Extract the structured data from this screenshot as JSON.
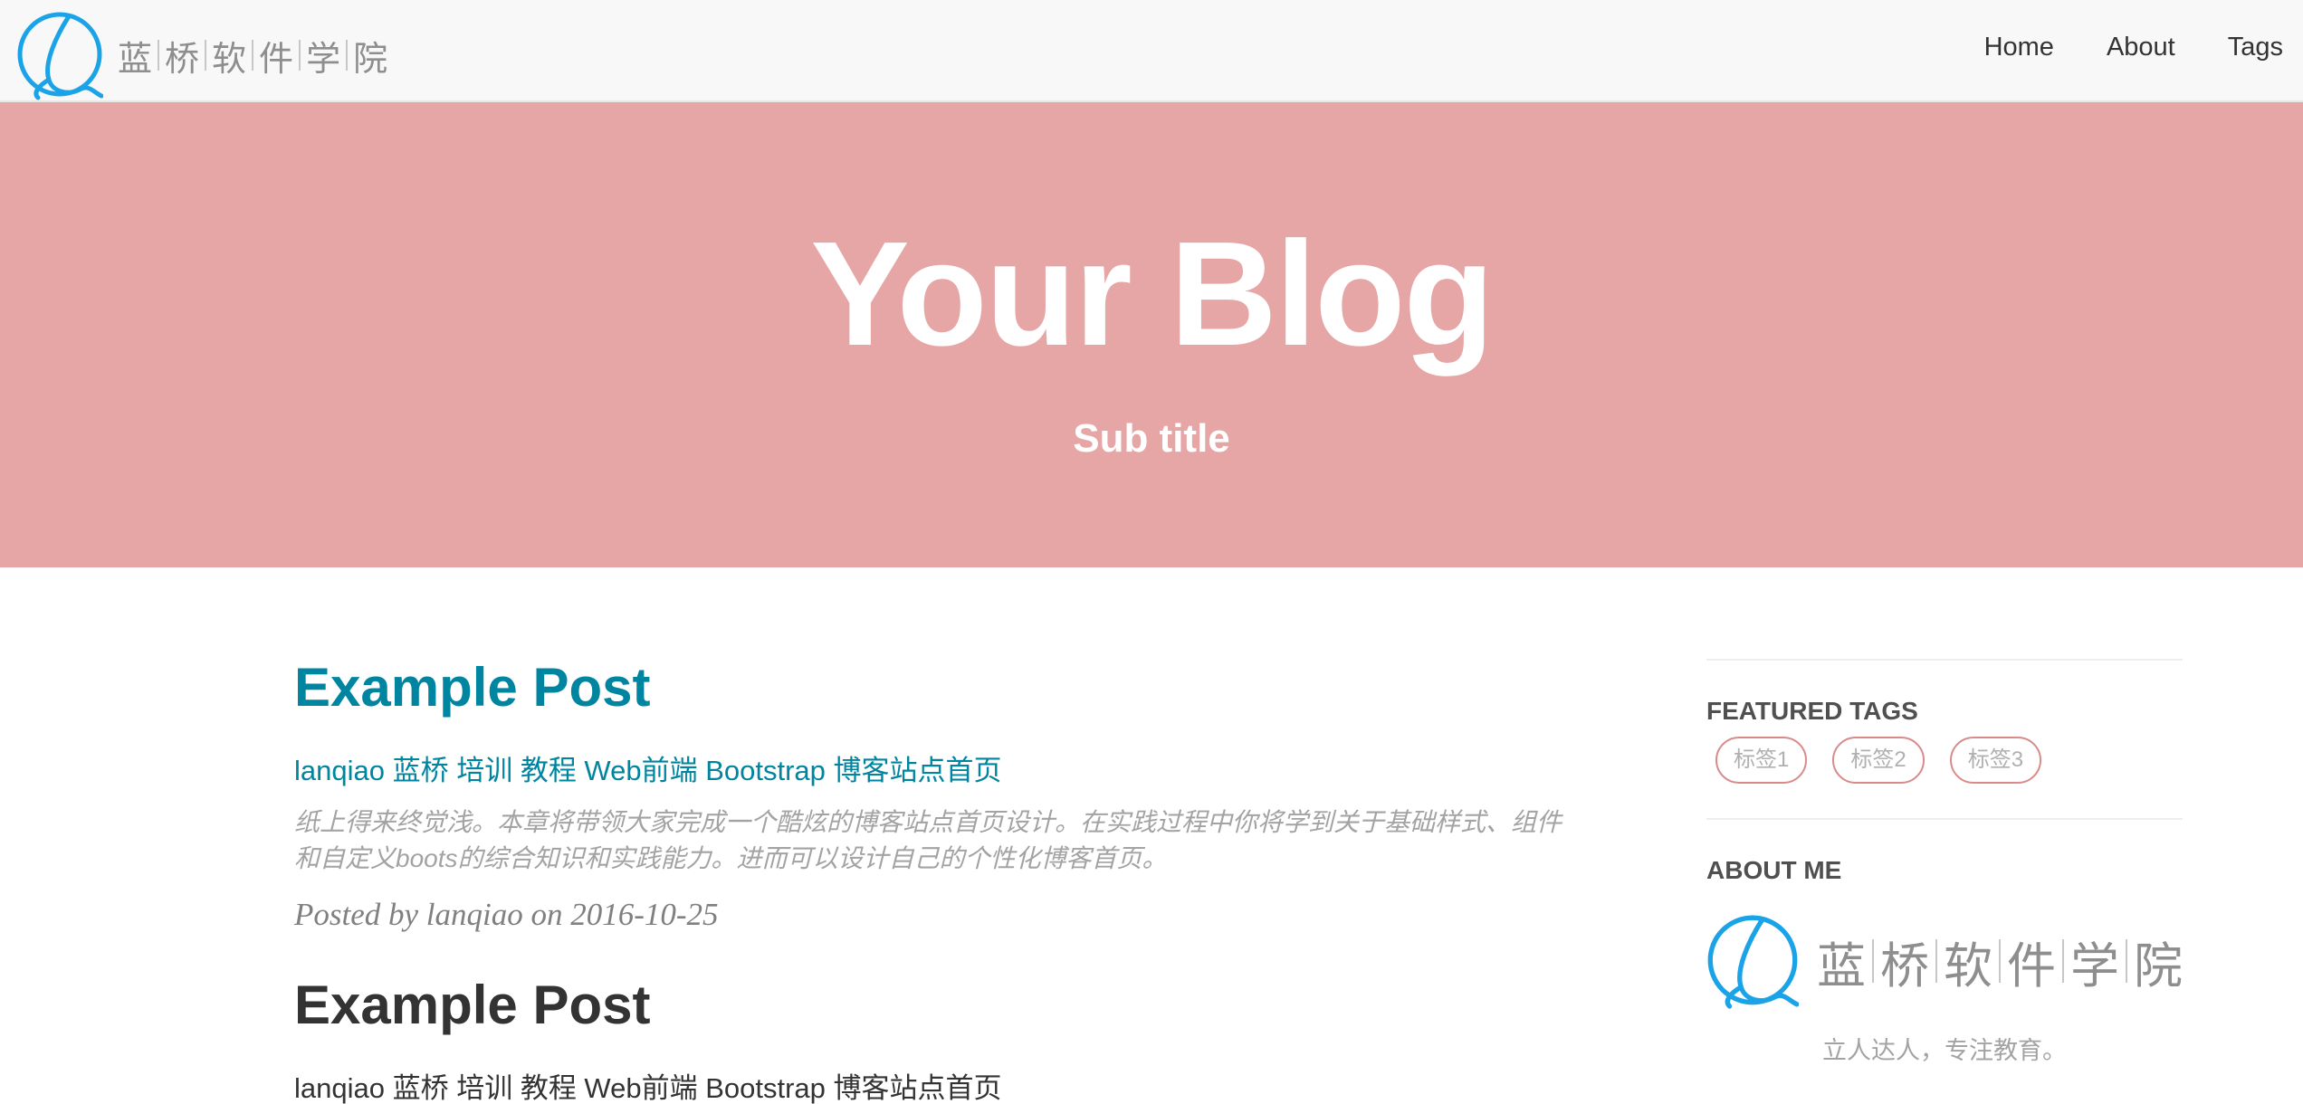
{
  "brand": {
    "logo_icon": "lanqiao-logo-icon",
    "chars": [
      "蓝",
      "桥",
      "软",
      "件",
      "学",
      "院"
    ],
    "logo_color": "#1ba3e8"
  },
  "nav": {
    "items": [
      {
        "label": "Home"
      },
      {
        "label": "About"
      },
      {
        "label": "Tags"
      }
    ]
  },
  "hero": {
    "title": "Your Blog",
    "subtitle": "Sub title",
    "background": "#e6a6a6"
  },
  "posts": [
    {
      "title": "Example Post",
      "subtitle": "lanqiao 蓝桥 培训 教程 Web前端 Bootstrap 博客站点首页",
      "excerpt": "纸上得来终觉浅。本章将带领大家完成一个酷炫的博客站点首页设计。在实践过程中你将学到关于基础样式、组件和自定义boots的综合知识和实践能力。进而可以设计自己的个性化博客首页。",
      "meta": "Posted by lanqiao on 2016-10-25"
    },
    {
      "title": "Example Post",
      "subtitle": "lanqiao 蓝桥 培训 教程 Web前端 Bootstrap 博客站点首页"
    }
  ],
  "sidebar": {
    "featured_heading": "FEATURED TAGS",
    "tags": [
      "标签1",
      "标签2",
      "标签3"
    ],
    "about_heading": "ABOUT ME",
    "about_chars": [
      "蓝",
      "桥",
      "软",
      "件",
      "学",
      "院"
    ],
    "about_desc": "立人达人，专注教育。"
  },
  "colors": {
    "link_active": "#0085a1",
    "tag_border": "#d98a8a",
    "navbar_bg": "#f8f8f8"
  }
}
